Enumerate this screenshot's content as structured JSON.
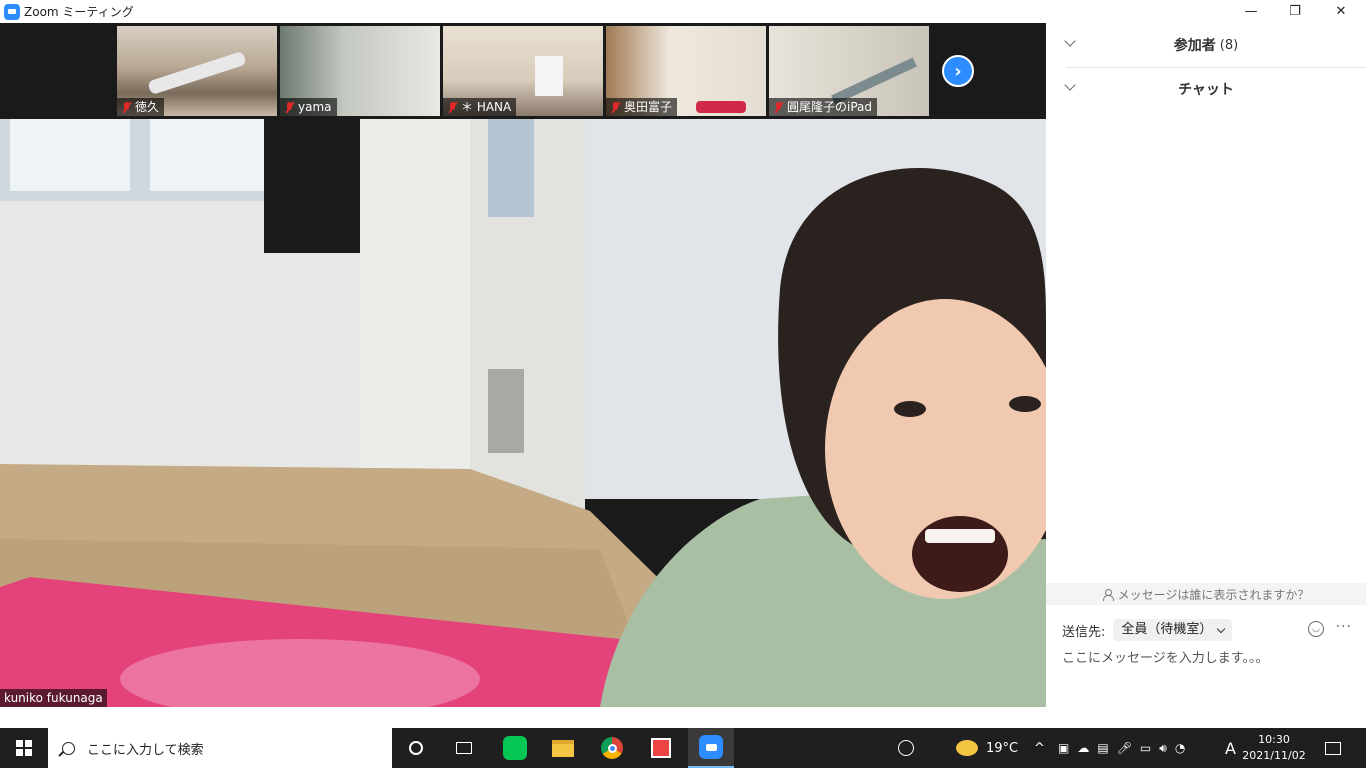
{
  "window": {
    "title": "Zoom ミーティング",
    "minimize_glyph": "—",
    "restore_glyph": "❐",
    "close_glyph": "✕"
  },
  "thumbnails": [
    {
      "name": "徳久",
      "muted": true
    },
    {
      "name": "yama",
      "muted": true
    },
    {
      "name": "＊ HANA",
      "muted": true
    },
    {
      "name": "奥田富子",
      "muted": true
    },
    {
      "name": "圓尾隆子のiPad",
      "muted": true
    }
  ],
  "main_speaker": {
    "name": "kuniko fukunaga"
  },
  "panel": {
    "participants_label": "参加者",
    "participants_count": "(8)",
    "chat_label": "チャット",
    "who_can_see": "メッセージは誰に表示されますか？",
    "send_to_label": "送信先:",
    "recipient": "全員（待機室）",
    "message_placeholder": "ここにメッセージを入力します。。。"
  },
  "taskbar": {
    "search_placeholder": "ここに入力して検索",
    "weather_temp": "19°C",
    "ime_mode": "A",
    "time": "10:30",
    "date": "2021/11/02"
  },
  "colors": {
    "zoom_blue": "#2d8cff",
    "muted_red": "#e02828",
    "taskbar_bg": "#1f1f1f"
  }
}
